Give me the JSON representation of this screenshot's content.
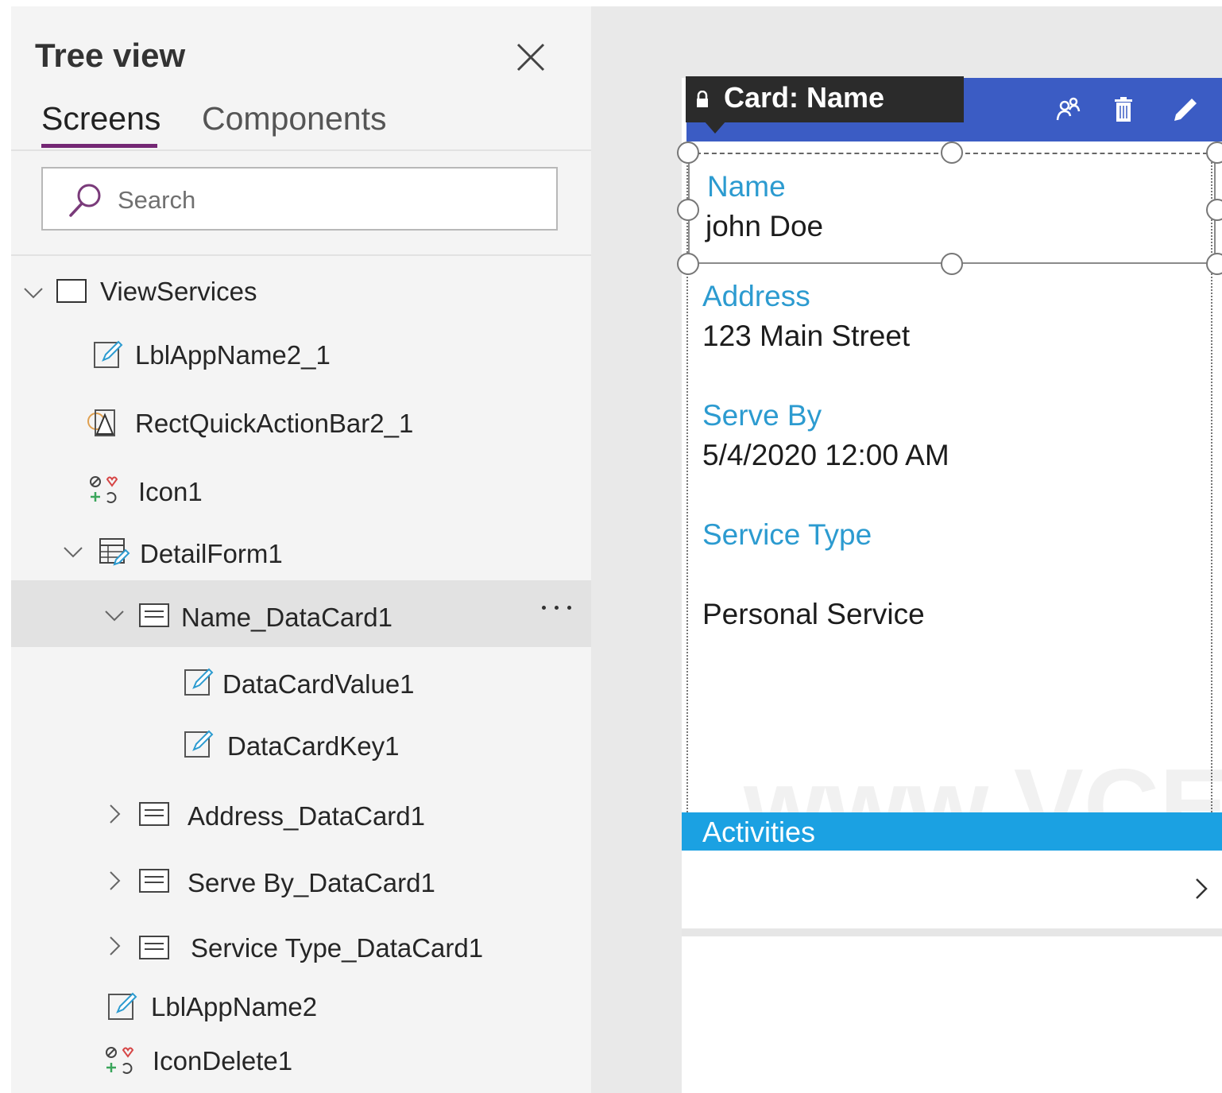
{
  "tree_panel": {
    "title": "Tree view",
    "tabs": [
      {
        "label": "Screens",
        "active": true
      },
      {
        "label": "Components",
        "active": false
      }
    ],
    "search": {
      "placeholder": "Search",
      "value": ""
    },
    "items": [
      {
        "label": "ViewServices",
        "icon": "screen-icon",
        "expanded": true
      },
      {
        "label": "LblAppName2_1",
        "icon": "label-icon"
      },
      {
        "label": "RectQuickActionBar2_1",
        "icon": "shape-icon"
      },
      {
        "label": "Icon1",
        "icon": "icons-icon"
      },
      {
        "label": "DetailForm1",
        "icon": "form-icon",
        "expanded": true
      },
      {
        "label": "Name_DataCard1",
        "icon": "datacard-icon",
        "expanded": true,
        "selected": true
      },
      {
        "label": "DataCardValue1",
        "icon": "label-icon"
      },
      {
        "label": "DataCardKey1",
        "icon": "label-icon"
      },
      {
        "label": "Address_DataCard1",
        "icon": "datacard-icon",
        "expanded": false
      },
      {
        "label": "Serve By_DataCard1",
        "icon": "datacard-icon",
        "expanded": false
      },
      {
        "label": "Service Type_DataCard1",
        "icon": "datacard-icon",
        "expanded": false
      },
      {
        "label": "LblAppName2",
        "icon": "label-icon"
      },
      {
        "label": "IconDelete1",
        "icon": "icons-icon"
      }
    ]
  },
  "canvas": {
    "card_tag": "Card: Name",
    "header_icons": [
      "people-icon",
      "trash-icon",
      "pencil-icon"
    ],
    "fields": [
      {
        "key": "Name",
        "value": "john Doe"
      },
      {
        "key": "Address",
        "value": "123 Main Street"
      },
      {
        "key": "Serve By",
        "value": "5/4/2020 12:00 AM"
      },
      {
        "key": "Service Type",
        "value": "Personal Service"
      }
    ],
    "activities_label": "Activities",
    "watermark": "www.VCE"
  },
  "colors": {
    "accent_purple": "#742774",
    "card_header_blue": "#3b5cc4",
    "field_key_blue": "#2c9bd0",
    "activities_blue": "#1ba1e2",
    "tag_dark": "#2b2b2b"
  }
}
